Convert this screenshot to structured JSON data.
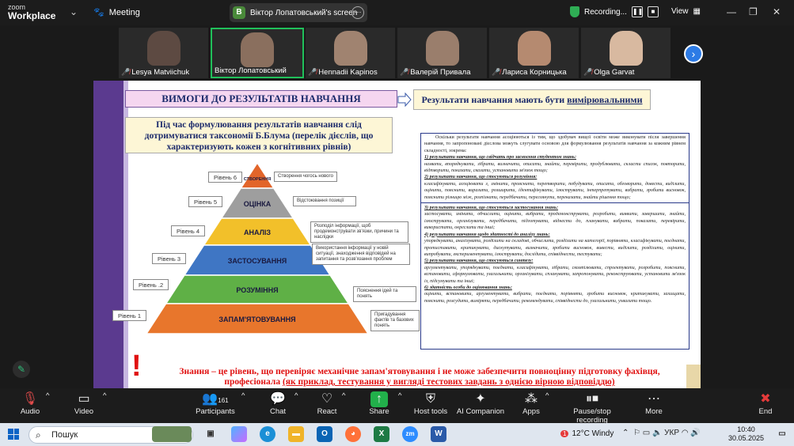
{
  "app": {
    "logo_top": "zoom",
    "logo_bottom": "Workplace",
    "meeting_label": "Meeting",
    "screen_badge": "B",
    "screen_label": "Віктор Лопатовський's screen",
    "recording_label": "Recording...",
    "view_label": "View"
  },
  "participants": [
    {
      "name": "Lesya Matviichuk",
      "muted": true,
      "face": "#6b5a52"
    },
    {
      "name": "Віктор Лопатовський",
      "muted": false,
      "face": "#8a6f5e"
    },
    {
      "name": "Hennadii Kapinos",
      "muted": true,
      "face": "#a08370"
    },
    {
      "name": "Валерій Привала",
      "muted": true,
      "face": "#9a7e6c"
    },
    {
      "name": "Лариса Корницька",
      "muted": true,
      "face": "#b58a70"
    },
    {
      "name": "Olga Garvat",
      "muted": true,
      "face": "#d8b9a0"
    }
  ],
  "slide": {
    "header_left": "ВИМОГИ ДО РЕЗУЛЬТАТІВ НАВЧАННЯ",
    "header_right_prefix": "Результати навчання мають бути ",
    "header_right_emph": "вимірювальними",
    "intro": "Під час формулювання результатів навчання слід дотримуватися таксономії Б.Блума (перелік дієслів, що характеризують кожен з когнітивних рівнів)",
    "pyramid": [
      {
        "label": "СТВОРЕННЯ",
        "level": "Рівень  6",
        "note": "Створення чогось нового",
        "color": "#e2652a"
      },
      {
        "label": "ОЦІНКА",
        "level": "Рівень  5",
        "note": "Відстоювання позиції",
        "color": "#9e9e9e"
      },
      {
        "label": "АНАЛІЗ",
        "level": "Рівень  4",
        "note": "Розподіл інформації, щоб продемонструвати зв'язки, причини та наслідки",
        "color": "#f2c02a"
      },
      {
        "label": "ЗАСТОСУВАННЯ",
        "level": "Рівень  3",
        "note": "Використання інформації у новій ситуації, знаходження відповідей на запитання та розв'язання проблем",
        "color": "#3f76c4"
      },
      {
        "label": "РОЗУМІННЯ",
        "level": "Рівень  .2",
        "note": "Пояснення ідей та понять",
        "color": "#5fb046"
      },
      {
        "label": "ЗАПАМ'ЯТОВУВАННЯ",
        "level": "Рівень  1",
        "note": "Пригадування фактів та базових понять",
        "color": "#e8762c"
      }
    ],
    "text_intro": "Оскільки результати навчання асоціюються із тим, що здобувач вищої освіти може виконувати після завершення навчання, то запропоновані дієслова можуть слугувати основою для формулювання результатів навчання за кожним рівнем складності, зокрема:",
    "text_blocks": [
      {
        "head": "1) результати навчання, що свідчать про засвоєння студентом знань:",
        "body": "назвати, впорядкувати, зібрати, визначити, описати, знайти, перевірити, продублювати, скласти список, повторити, відтворити, показати, сказати, установити зв'язок тощо;"
      },
      {
        "head": "2) результати навчання, що стосуються розуміння:",
        "body": "класифікувати, асоціювати з, змінити, прояснити, перетворити, побудувати, описати, обговорити, довести, виділити, оцінити, пояснити, виразити, розширити, ідентифікувати, ілюструвати, інтерпретувати, вибрати, зробити висновок, пояснити різницю між, розпізнати, передбачити, переглянути, переказати, знайти рішення тощо;"
      },
      {
        "head": "3) результати навчання, що стосуються застосування знань:",
        "body": "застосувати, змінити, обчислити, оцінити, вибрати, продемонструвати, розробити, виявити, завершити, знайти, ілюструвати, організувати, передбачити, підготувати, віднести до, планувати, вибрати, показати, перевірити, використати, окреслити та інші;"
      },
      {
        "head": "4) результати навчання щодо здатності до аналізу знань:",
        "body": "упорядкувати, аналізувати, розділити на складові, обчислити, розділити на категорії, порівняти, класифікувати, поєднати, протиставити, критикувати, дискутувати, визначити, зробити висновок, вивести, виділити, розділити, оцінити, випробувати, експериментувати, ілюструвати, дослідити, співвіднести, тестувати;"
      },
      {
        "head": "5) результати навчання, що стосуються синтезу:",
        "body": "аргументувати, упорядкувати, поєднати, класифікувати, зібрати, скомпілювати, спроектувати, розробити, пояснити, встановити, сформулювати, узагальнити, організувати, спланувати, запропонувати, реконструювати, установити зв'язок із, підсумувати та інші;"
      },
      {
        "head": "6) здатність особи до оцінювання знань:",
        "body": "оцінити, встановити, аргументувати, вибрати, поєднати, порівняти, зробити висновок, критикувати, захищати, пояснити, розсудити, виміряти, передбачити, рекомендувати, співвіднести до, узагальнити, ухвалити тощо."
      }
    ],
    "bottom_line1": "Знання – це рівень, що перевіряє механічне запам'ятовування і не може забезпечити повноцінну підготовку фахівця,",
    "bottom_line2_prefix": "професіонала ",
    "bottom_line2_emph": "(як приклад, тестування у вигляді тестових завдань з однією вірною відповіддю)"
  },
  "toolbar": {
    "audio": "Audio",
    "video": "Video",
    "participants": "Participants",
    "participants_count": "161",
    "chat": "Chat",
    "react": "React",
    "share": "Share",
    "host_tools": "Host tools",
    "ai": "AI Companion",
    "apps": "Apps",
    "pause_rec": "Pause/stop recording",
    "more": "More",
    "end": "End"
  },
  "taskbar": {
    "search": "Пошук",
    "weather": "12°C  Windy",
    "lang": "УКР",
    "time": "10:40",
    "date": "30.05.2025",
    "badge": "1"
  }
}
